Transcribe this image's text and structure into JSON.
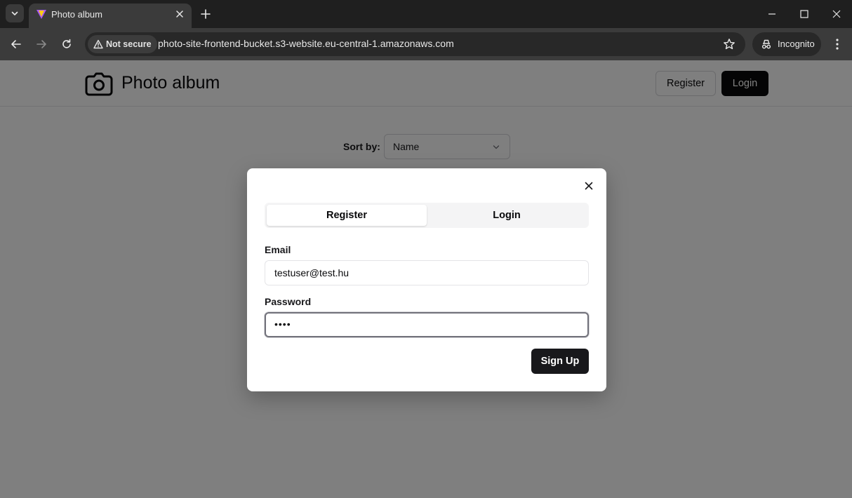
{
  "browser": {
    "tab_title": "Photo album",
    "security_label": "Not secure",
    "url": "photo-site-frontend-bucket.s3-website.eu-central-1.amazonaws.com",
    "profile_label": "Incognito"
  },
  "site": {
    "title": "Photo album",
    "register_label": "Register",
    "login_label": "Login"
  },
  "sort": {
    "label": "Sort by:",
    "selected": "Name"
  },
  "modal": {
    "tabs": [
      {
        "label": "Register",
        "active": true
      },
      {
        "label": "Login",
        "active": false
      }
    ],
    "email_label": "Email",
    "email_value": "testuser@test.hu",
    "password_label": "Password",
    "password_value": "••••",
    "submit_label": "Sign Up"
  }
}
